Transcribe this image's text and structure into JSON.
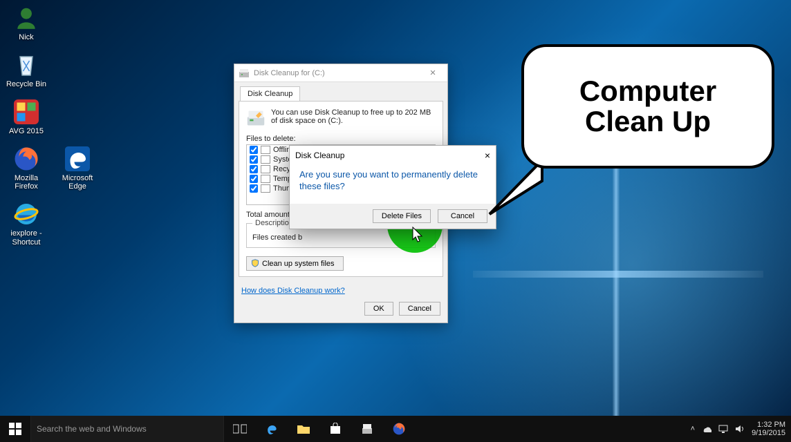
{
  "desktop_icons": {
    "user": "Nick",
    "recycle": "Recycle Bin",
    "avg": "AVG 2015",
    "firefox": "Mozilla Firefox",
    "edge": "Microsoft Edge",
    "ie": "iexplore - Shortcut"
  },
  "disk_cleanup": {
    "title": "Disk Cleanup for  (C:)",
    "tab": "Disk Cleanup",
    "blurb": "You can use Disk Cleanup to free up to 202 MB of disk space on  (C:).",
    "files_to_delete_label": "Files to delete:",
    "items": [
      {
        "label": "Offline w",
        "checked": true
      },
      {
        "label": "System",
        "checked": true
      },
      {
        "label": "Recycle",
        "checked": true
      },
      {
        "label": "Tempor",
        "checked": true
      },
      {
        "label": "Thumbn",
        "checked": true
      }
    ],
    "total_label": "Total amount of",
    "description_legend": "Description",
    "description_body": "Files created b",
    "cleanup_sys": "Clean up system files",
    "help_link": "How does Disk Cleanup work?",
    "ok": "OK",
    "cancel": "Cancel"
  },
  "confirm": {
    "title": "Disk Cleanup",
    "message": "Are you sure you want to permanently delete these files?",
    "delete": "Delete Files",
    "cancel": "Cancel"
  },
  "bubble": {
    "line1": "Computer",
    "line2": "Clean Up"
  },
  "taskbar": {
    "search_placeholder": "Search the web and Windows",
    "time": "1:32 PM",
    "date": "9/19/2015"
  }
}
